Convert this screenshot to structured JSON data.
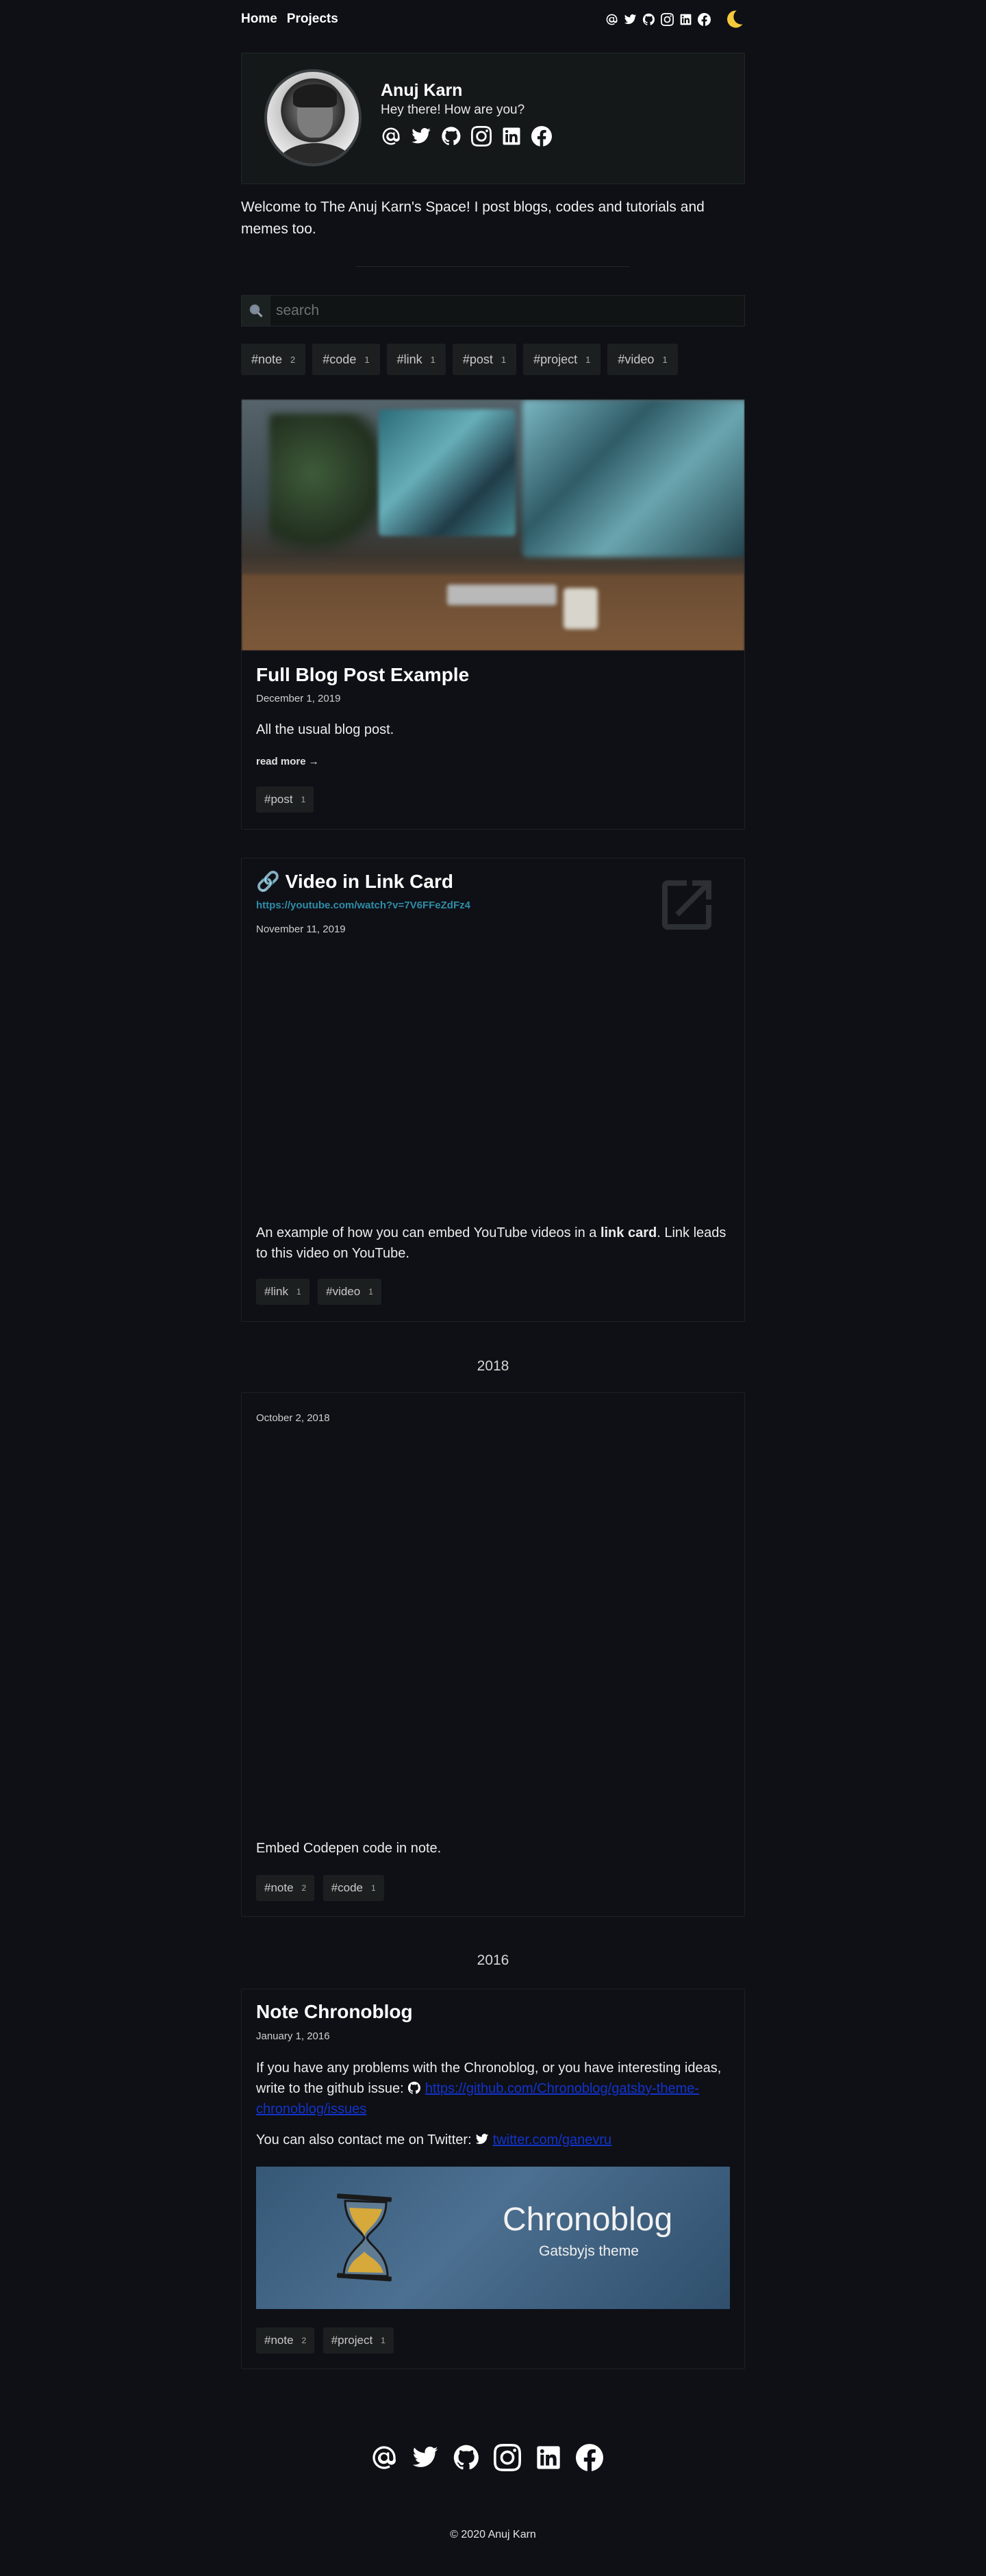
{
  "nav": {
    "home": "Home",
    "projects": "Projects",
    "social_icons": [
      "at-icon",
      "twitter-icon",
      "github-icon",
      "instagram-icon",
      "linkedin-icon",
      "facebook-icon"
    ],
    "theme_toggle": "moon-icon"
  },
  "profile": {
    "name": "Anuj Karn",
    "tagline": "Hey there! How are you?"
  },
  "welcome": "Welcome to The Anuj Karn's Space! I post blogs, codes and tutorials and memes too.",
  "search": {
    "placeholder": "search"
  },
  "tags": [
    {
      "label": "#note",
      "count": "2"
    },
    {
      "label": "#code",
      "count": "1"
    },
    {
      "label": "#link",
      "count": "1"
    },
    {
      "label": "#post",
      "count": "1"
    },
    {
      "label": "#project",
      "count": "1"
    },
    {
      "label": "#video",
      "count": "1"
    }
  ],
  "post1": {
    "title": "Full Blog Post Example",
    "date": "December 1, 2019",
    "text": "All the usual blog post.",
    "read_more": "read more →",
    "tags": [
      {
        "label": "#post",
        "count": "1"
      }
    ]
  },
  "post2": {
    "title": "🔗 Video in Link Card",
    "url": "https://youtube.com/watch?v=7V6FFeZdFz4",
    "date": "November 11, 2019",
    "text_a": "An example of how you can embed YouTube videos in a ",
    "text_bold": "link card",
    "text_b": ". Link leads to this video on YouTube.",
    "tags": [
      {
        "label": "#link",
        "count": "1"
      },
      {
        "label": "#video",
        "count": "1"
      }
    ]
  },
  "year1": "2018",
  "post3": {
    "date": "October 2, 2018",
    "text": "Embed Codepen code in note.",
    "tags": [
      {
        "label": "#note",
        "count": "2"
      },
      {
        "label": "#code",
        "count": "1"
      }
    ]
  },
  "year2": "2016",
  "post4": {
    "title": "Note Chronoblog",
    "date": "January 1, 2016",
    "text1": "If you have any problems with the Chronoblog, or you have interesting ideas, write to the github issue:",
    "link1": "https://github.com/Chronoblog/gatsby-theme-chronoblog/issues",
    "text2": "You can also contact me on Twitter:",
    "link2": "twitter.com/ganevru",
    "banner_title": "Chronoblog",
    "banner_sub": "Gatsbyjs theme",
    "tags": [
      {
        "label": "#note",
        "count": "2"
      },
      {
        "label": "#project",
        "count": "1"
      }
    ]
  },
  "footer": {
    "copyright": "© 2020 Anuj Karn"
  }
}
